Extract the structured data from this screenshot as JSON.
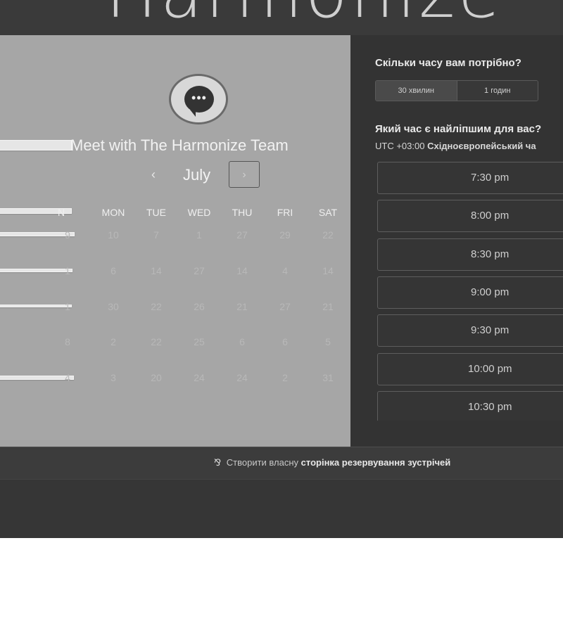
{
  "header": {
    "brand": "Harmonize"
  },
  "booking": {
    "title": "Meet with The Harmonize Team",
    "month": "July",
    "prev_icon": "‹",
    "next_icon": "›",
    "days_of_week": [
      "MON",
      "TUE",
      "WED",
      "THU",
      "FRI",
      "SAT"
    ],
    "sun_partial": "N",
    "rows": [
      {
        "first": "9",
        "cells": [
          "10",
          "7",
          "1",
          "27",
          "29",
          "22"
        ]
      },
      {
        "first": "1",
        "cells": [
          "6",
          "14",
          "27",
          "14",
          "4",
          "14"
        ]
      },
      {
        "first": "1",
        "cells": [
          "30",
          "22",
          "26",
          "21",
          "27",
          "21"
        ]
      },
      {
        "first": "8",
        "cells": [
          "2",
          "22",
          "25",
          "6",
          "6",
          "5"
        ]
      },
      {
        "first": "4",
        "cells": [
          "3",
          "20",
          "24",
          "24",
          "2",
          "31"
        ]
      }
    ]
  },
  "right_panel": {
    "duration_question": "Скільки часу вам потрібно?",
    "durations": [
      "30 хвилин",
      "1 годин"
    ],
    "time_question": "Який час є найліпшим для вас?",
    "tz_offset": "UTC +03:00",
    "tz_name": "Східноєвропейський ча",
    "slots": [
      "7:30 pm",
      "8:00 pm",
      "8:30 pm",
      "9:00 pm",
      "9:30 pm",
      "10:00 pm",
      "10:30 pm"
    ]
  },
  "footer": {
    "icon": "⅋",
    "prefix": "Створити власну",
    "link": "сторінка резервування зустрічей"
  }
}
